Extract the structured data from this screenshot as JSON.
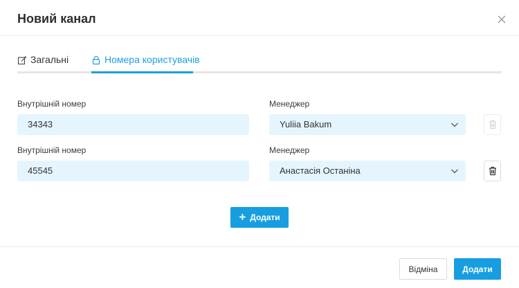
{
  "dialog": {
    "title": "Новий канал"
  },
  "tabs": [
    {
      "label": "Загальні",
      "icon": "edit-icon",
      "active": false
    },
    {
      "label": "Номера користувачів",
      "icon": "lock-icon",
      "active": true
    }
  ],
  "rows": [
    {
      "number_label": "Внутрішній номер",
      "number_value": "34343",
      "manager_label": "Менеджер",
      "manager_value": "Yuliia Bakum",
      "delete_enabled": false
    },
    {
      "number_label": "Внутрішній номер",
      "number_value": "45545",
      "manager_label": "Менеджер",
      "manager_value": "Анастасія Останіна",
      "delete_enabled": true
    }
  ],
  "add_button": {
    "label": "Додати",
    "icon": "plus-icon"
  },
  "footer": {
    "cancel_label": "Відміна",
    "submit_label": "Додати"
  },
  "colors": {
    "accent": "#169ee0",
    "field_bg": "#e5f5fd"
  }
}
